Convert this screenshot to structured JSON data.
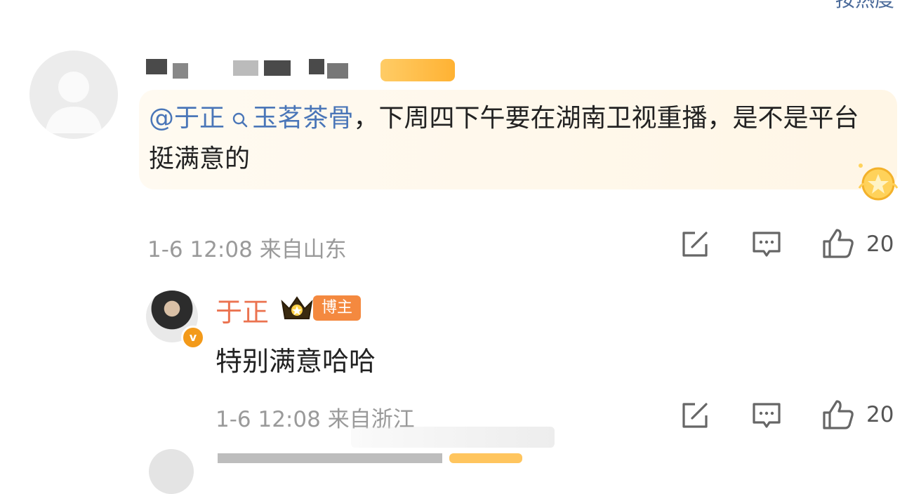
{
  "top": {
    "sort_label": "按热度"
  },
  "comment1": {
    "mention": "@于正",
    "topic": "玉茗茶骨",
    "text_rest": "，下周四下午要在湖南卫视重播，是不是平台挺满意的",
    "time": "1-6 12:08",
    "location": "来自山东",
    "like_count": "20"
  },
  "reply": {
    "username": "于正",
    "author_tag": "博主",
    "verified_badge": "v",
    "text": "特别满意哈哈",
    "time": "1-6 12:08",
    "location": "来自浙江",
    "like_count": "20"
  },
  "icons": {
    "share": "share-icon",
    "comment": "comment-icon",
    "like": "thumbs-up-icon",
    "medal": "medal-icon",
    "crown": "crown-icon"
  },
  "colors": {
    "link": "#4a76b8",
    "author_name": "#eb7350",
    "tag_bg": "#f4893f",
    "meta": "#9a9a9a",
    "bubble_bg": "#fff7e9"
  }
}
